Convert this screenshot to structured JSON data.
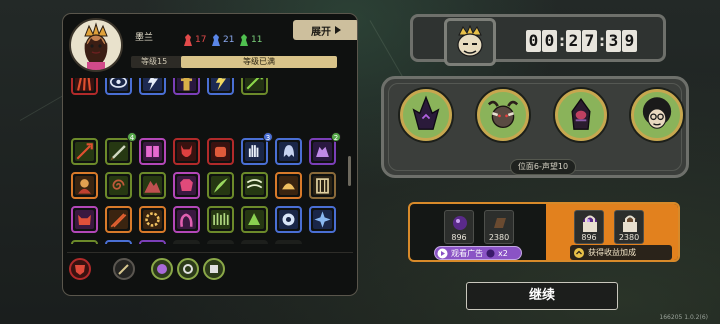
{
  "profile": {
    "name": "墨兰",
    "stats": [
      {
        "icon": "red-unit-icon",
        "value": "17",
        "color": "#e24a4a"
      },
      {
        "icon": "blue-unit-icon",
        "value": "21",
        "color": "#5a86e8"
      },
      {
        "icon": "green-unit-icon",
        "value": "11",
        "color": "#4fc04f"
      }
    ],
    "expand_label": "展开",
    "level_label": "等级15",
    "level_status": "等级已满",
    "level_progress": 1.0
  },
  "items": {
    "badges": [
      "4",
      "3",
      "2"
    ]
  },
  "timer": {
    "digits": [
      "0",
      "0",
      "2",
      "7",
      "3",
      "9"
    ]
  },
  "enemies": {
    "position_label": "位面6-声望10"
  },
  "rewards": {
    "left": [
      {
        "icon": "purple-orb-icon",
        "value": "896"
      },
      {
        "icon": "brown-crate-icon",
        "value": "2380"
      }
    ],
    "right": [
      {
        "icon": "purple-orb-icon",
        "value": "896"
      },
      {
        "icon": "brown-crate-icon",
        "value": "2380"
      }
    ],
    "ad_label": "观看广告",
    "ad_multiplier": "x2",
    "gain_label": "获得收益加成"
  },
  "continue_label": "继续",
  "version": "166205 1.0.2(6)",
  "colors": {
    "accent_orange": "#e2811e",
    "panel_border": "#5a564c",
    "enemy_ring": "#c7a74f",
    "level_fill": "#d9c48a"
  }
}
